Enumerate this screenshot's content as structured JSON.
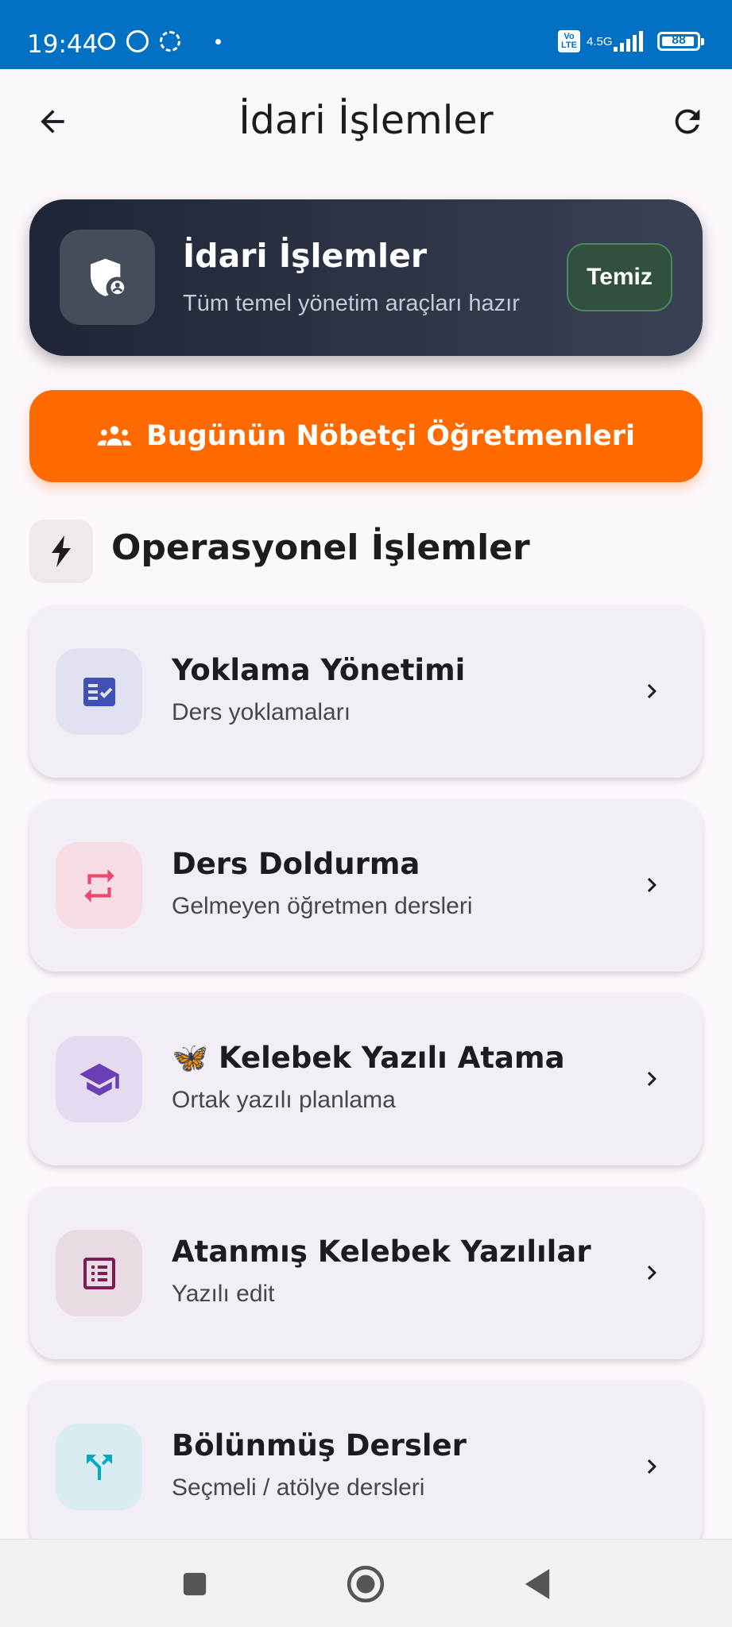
{
  "status_bar": {
    "time": "19:44",
    "network": "4.5G",
    "volte": "Vo LTE",
    "battery": "88"
  },
  "app_bar": {
    "title": "İdari İşlemler",
    "back_icon": "arrow-back-icon",
    "refresh_icon": "refresh-icon"
  },
  "hero": {
    "title": "İdari İşlemler",
    "subtitle": "Tüm temel yönetim araçları hazır",
    "status": "Temiz",
    "icon": "admin-shield-icon"
  },
  "duty_button": {
    "label": "Bugünün Nöbetçi Öğretmenleri",
    "icon": "groups-icon"
  },
  "section": {
    "title": "Operasyonel İşlemler",
    "icon": "bolt-icon"
  },
  "cards": [
    {
      "title": "Yoklama Yönetimi",
      "subtitle": "Ders yoklamaları",
      "icon": "fact-check-icon",
      "accent": "#3f51b5",
      "tint": "#e2e1f1"
    },
    {
      "title": "Ders Doldurma",
      "subtitle": "Gelmeyen öğretmen dersleri",
      "icon": "swap-icon",
      "accent": "#e84a6f",
      "tint": "#f7dce5"
    },
    {
      "title": "🦋 Kelebek Yazılı Atama",
      "subtitle": "Ortak yazılı planlama",
      "icon": "school-icon",
      "accent": "#6a3fb5",
      "tint": "#e4dbf0"
    },
    {
      "title": "Atanmış Kelebek Yazılılar",
      "subtitle": "Yazılı edit",
      "icon": "list-alt-icon",
      "accent": "#7a1e55",
      "tint": "#e8dbe3"
    },
    {
      "title": "Bölünmüş Dersler",
      "subtitle": "Seçmeli / atölye dersleri",
      "icon": "call-split-icon",
      "accent": "#00acc1",
      "tint": "#d8ecf2"
    }
  ],
  "colors": {
    "status_bar": "#0271c3",
    "hero_bg": "#1f2536",
    "duty_orange": "#ff6a00",
    "status_green": "#32503f",
    "background": "#fcf7fc"
  },
  "nav": {
    "recents_icon": "square-icon",
    "home_icon": "circle-icon",
    "back_icon": "triangle-back-icon"
  }
}
